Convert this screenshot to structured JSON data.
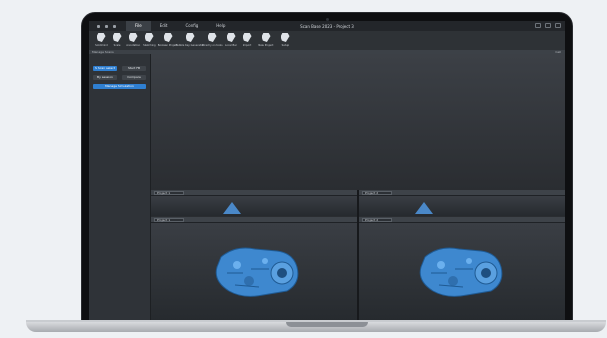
{
  "app": {
    "title": "Scan Base 2023 - Project 3",
    "menu": [
      {
        "label": "File",
        "active": true
      },
      {
        "label": "Edit",
        "active": false
      },
      {
        "label": "Config",
        "active": false
      },
      {
        "label": "Help",
        "active": false
      }
    ]
  },
  "ribbon": {
    "items": [
      {
        "label": "Solidmind",
        "icon": "tool-icon"
      },
      {
        "label": "Scale",
        "icon": "tool-icon"
      },
      {
        "label": "Annotation",
        "icon": "tool-icon"
      },
      {
        "label": "Sketching",
        "icon": "tool-icon"
      },
      {
        "label": "Boolean Project",
        "icon": "tool-icon"
      },
      {
        "label": "Bubble Key Generator",
        "icon": "tool-icon"
      },
      {
        "label": "Strachy on tools",
        "icon": "tool-icon"
      },
      {
        "label": "Local Bar",
        "icon": "tool-icon"
      },
      {
        "label": "Import",
        "icon": "tool-icon"
      },
      {
        "label": "New Project",
        "icon": "tool-icon"
      },
      {
        "label": "Setup",
        "icon": "tool-icon"
      }
    ]
  },
  "status": {
    "left": "Manage Scans",
    "right": "Cell"
  },
  "left_panel": {
    "row1": [
      "S Scan select",
      "Start FB"
    ],
    "row2": [
      "By session",
      "Compare"
    ],
    "active": "Manage Simulation"
  },
  "viewports": {
    "top_left": "Project 1",
    "top_right": "Project 2",
    "bottom_left": "Project 1",
    "bottom_right": "Project 2"
  },
  "colors": {
    "accent": "#2f7fd1",
    "model": "#3e88cf"
  }
}
